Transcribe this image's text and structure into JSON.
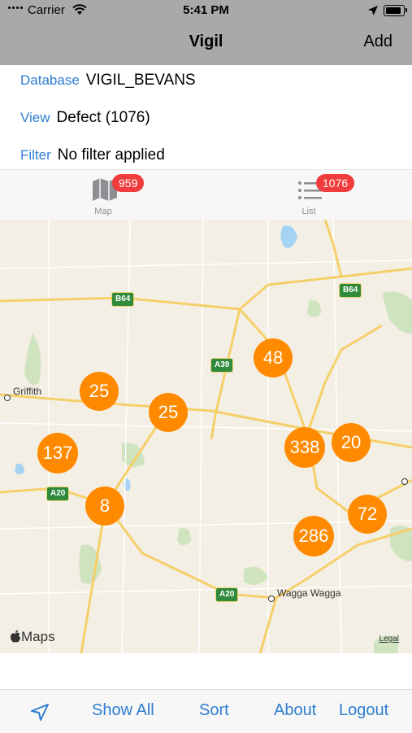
{
  "status_bar": {
    "carrier": "Carrier",
    "time": "5:41 PM"
  },
  "nav": {
    "title": "Vigil",
    "add_label": "Add"
  },
  "info": {
    "database_label": "Database",
    "database_value": "VIGIL_BEVANS",
    "view_label": "View",
    "view_value": "Defect (1076)",
    "filter_label": "Filter",
    "filter_value": "No filter applied"
  },
  "tabs": [
    {
      "label": "Map",
      "badge": "959",
      "icon": "map-icon"
    },
    {
      "label": "List",
      "badge": "1076",
      "icon": "list-icon"
    }
  ],
  "map": {
    "clusters": [
      "48",
      "25",
      "25",
      "137",
      "338",
      "20",
      "8",
      "72",
      "286"
    ],
    "towns": [
      "Griffith",
      "Wagga Wagga"
    ],
    "road_shields": [
      "B64",
      "B64",
      "A39",
      "A20",
      "A20"
    ],
    "attribution": "Maps",
    "legal": "Legal"
  },
  "toolbar": {
    "location_icon": "location-arrow-icon",
    "show_all": "Show All",
    "sort": "Sort",
    "about": "About",
    "logout": "Logout"
  },
  "colors": {
    "accent": "#2e7dd1",
    "cluster": "#ff8a00",
    "badge": "#f03c3c"
  }
}
